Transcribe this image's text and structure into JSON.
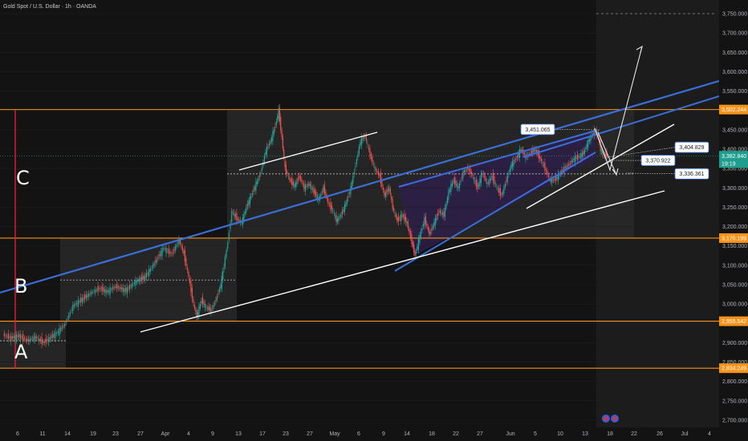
{
  "header": {
    "title": "Gold Spot / U.S. Dollar · 1h · OANDA"
  },
  "colors": {
    "background": "#131313",
    "up": "#26a69a",
    "down": "#ef5350",
    "trend_blue": "#3b6fd8",
    "level_orange": "#f7931a",
    "current_green": "#1e9e8e",
    "channel_white": "#ffffff",
    "zone_fill": "#2a2a2a",
    "wedge_fill": "#2e1f4a"
  },
  "chart_data": {
    "type": "line",
    "title": "Gold Spot / U.S. Dollar · 1h · OANDA",
    "ylim": [
      2680,
      3775
    ],
    "y_ticks": [
      2700,
      2750,
      2800,
      2850,
      2900,
      2950,
      3000,
      3050,
      3100,
      3150,
      3200,
      3250,
      3300,
      3350,
      3400,
      3450,
      3500,
      3550,
      3600,
      3650,
      3700,
      3750
    ],
    "y_tick_labels": [
      "2,700.000",
      "2,750.000",
      "2,800.000",
      "2,850.000",
      "2,900.000",
      "2,950.000",
      "3,000.000",
      "3,050.000",
      "3,100.000",
      "3,150.000",
      "3,200.000",
      "3,250.000",
      "3,300.000",
      "3,350.000",
      "3,400.000",
      "3,450.000",
      "3,500.000",
      "3,550.000",
      "3,600.000",
      "3,650.000",
      "3,700.000",
      "3,750.000"
    ],
    "x_ticks": [
      {
        "label": "6",
        "pos": 22
      },
      {
        "label": "11",
        "pos": 53
      },
      {
        "label": "14",
        "pos": 84
      },
      {
        "label": "19",
        "pos": 116
      },
      {
        "label": "23",
        "pos": 144
      },
      {
        "label": "27",
        "pos": 175
      },
      {
        "label": "Apr",
        "pos": 206
      },
      {
        "label": "4",
        "pos": 235
      },
      {
        "label": "9",
        "pos": 265
      },
      {
        "label": "13",
        "pos": 297
      },
      {
        "label": "17",
        "pos": 327
      },
      {
        "label": "23",
        "pos": 356
      },
      {
        "label": "27",
        "pos": 386
      },
      {
        "label": "May",
        "pos": 417
      },
      {
        "label": "6",
        "pos": 447
      },
      {
        "label": "9",
        "pos": 478
      },
      {
        "label": "14",
        "pos": 507
      },
      {
        "label": "18",
        "pos": 538
      },
      {
        "label": "22",
        "pos": 568
      },
      {
        "label": "27",
        "pos": 598
      },
      {
        "label": "Jun",
        "pos": 636
      },
      {
        "label": "5",
        "pos": 667
      },
      {
        "label": "10",
        "pos": 698
      },
      {
        "label": "13",
        "pos": 729
      },
      {
        "label": "18",
        "pos": 760
      },
      {
        "label": "22",
        "pos": 790
      },
      {
        "label": "26",
        "pos": 822
      },
      {
        "label": "Jul",
        "pos": 853
      },
      {
        "label": "4",
        "pos": 884
      }
    ],
    "price_path": [
      [
        5,
        2920
      ],
      [
        15,
        2912
      ],
      [
        25,
        2918
      ],
      [
        35,
        2905
      ],
      [
        45,
        2915
      ],
      [
        55,
        2900
      ],
      [
        62,
        2910
      ],
      [
        72,
        2925
      ],
      [
        82,
        2948
      ],
      [
        92,
        2995
      ],
      [
        102,
        3010
      ],
      [
        115,
        3030
      ],
      [
        125,
        3040
      ],
      [
        135,
        3032
      ],
      [
        145,
        3045
      ],
      [
        158,
        3035
      ],
      [
        170,
        3058
      ],
      [
        182,
        3070
      ],
      [
        195,
        3110
      ],
      [
        205,
        3145
      ],
      [
        215,
        3128
      ],
      [
        224,
        3165
      ],
      [
        230,
        3130
      ],
      [
        236,
        3070
      ],
      [
        242,
        3000
      ],
      [
        246,
        2968
      ],
      [
        252,
        3010
      ],
      [
        258,
        2990
      ],
      [
        264,
        2985
      ],
      [
        270,
        3010
      ],
      [
        276,
        3050
      ],
      [
        280,
        3100
      ],
      [
        285,
        3160
      ],
      [
        290,
        3240
      ],
      [
        296,
        3220
      ],
      [
        302,
        3210
      ],
      [
        308,
        3250
      ],
      [
        314,
        3280
      ],
      [
        320,
        3310
      ],
      [
        326,
        3340
      ],
      [
        332,
        3395
      ],
      [
        338,
        3420
      ],
      [
        344,
        3460
      ],
      [
        348,
        3500
      ],
      [
        352,
        3430
      ],
      [
        356,
        3350
      ],
      [
        362,
        3320
      ],
      [
        368,
        3305
      ],
      [
        374,
        3330
      ],
      [
        380,
        3300
      ],
      [
        386,
        3310
      ],
      [
        392,
        3290
      ],
      [
        398,
        3270
      ],
      [
        404,
        3300
      ],
      [
        410,
        3260
      ],
      [
        416,
        3240
      ],
      [
        420,
        3215
      ],
      [
        426,
        3230
      ],
      [
        432,
        3260
      ],
      [
        438,
        3300
      ],
      [
        444,
        3360
      ],
      [
        450,
        3420
      ],
      [
        456,
        3435
      ],
      [
        462,
        3385
      ],
      [
        468,
        3350
      ],
      [
        474,
        3330
      ],
      [
        480,
        3280
      ],
      [
        486,
        3300
      ],
      [
        490,
        3250
      ],
      [
        496,
        3215
      ],
      [
        502,
        3230
      ],
      [
        508,
        3210
      ],
      [
        514,
        3160
      ],
      [
        518,
        3125
      ],
      [
        524,
        3175
      ],
      [
        530,
        3220
      ],
      [
        536,
        3180
      ],
      [
        542,
        3210
      ],
      [
        548,
        3240
      ],
      [
        554,
        3230
      ],
      [
        560,
        3290
      ],
      [
        566,
        3320
      ],
      [
        572,
        3300
      ],
      [
        578,
        3340
      ],
      [
        584,
        3350
      ],
      [
        590,
        3330
      ],
      [
        596,
        3300
      ],
      [
        602,
        3340
      ],
      [
        608,
        3310
      ],
      [
        614,
        3330
      ],
      [
        620,
        3300
      ],
      [
        626,
        3280
      ],
      [
        632,
        3320
      ],
      [
        638,
        3360
      ],
      [
        644,
        3375
      ],
      [
        650,
        3400
      ],
      [
        656,
        3380
      ],
      [
        662,
        3390
      ],
      [
        668,
        3400
      ],
      [
        674,
        3375
      ],
      [
        680,
        3350
      ],
      [
        686,
        3320
      ],
      [
        692,
        3320
      ],
      [
        698,
        3335
      ],
      [
        704,
        3350
      ],
      [
        710,
        3360
      ],
      [
        716,
        3375
      ],
      [
        722,
        3380
      ],
      [
        728,
        3390
      ],
      [
        734,
        3420
      ],
      [
        740,
        3440
      ],
      [
        745,
        3445
      ],
      [
        749,
        3400
      ],
      [
        753,
        3385
      ],
      [
        757,
        3383
      ]
    ],
    "horizontal_levels": [
      {
        "value": 3502.244,
        "label": "3,502.244",
        "x_end": 790,
        "color": "#f7931a"
      },
      {
        "value": 3170.199,
        "label": "3,170.199",
        "x_end": 790,
        "color": "#f7931a"
      },
      {
        "value": 2955.542,
        "label": "2,955.542",
        "x_end": 300,
        "color": "#f7931a"
      },
      {
        "value": 2834.249,
        "label": "2,834.249",
        "x_end": 82,
        "color": "#f7931a"
      }
    ],
    "current_price": {
      "value": 3382.84,
      "label": "3,382.840",
      "countdown": "19:19"
    },
    "callouts": [
      {
        "label": "3,451.065",
        "value": 3451.065,
        "x": 670
      },
      {
        "label": "3,404.829",
        "value": 3404.829,
        "x": 862
      },
      {
        "label": "3,370.922",
        "value": 3370.922,
        "x": 820
      },
      {
        "label": "3,336.361",
        "value": 3336.361,
        "x": 862
      }
    ],
    "zones": [
      {
        "label": "A",
        "value": 2880
      },
      {
        "label": "B",
        "value": 3050
      },
      {
        "label": "C",
        "value": 3330
      }
    ],
    "annotations": [
      "A",
      "B",
      "C"
    ]
  }
}
